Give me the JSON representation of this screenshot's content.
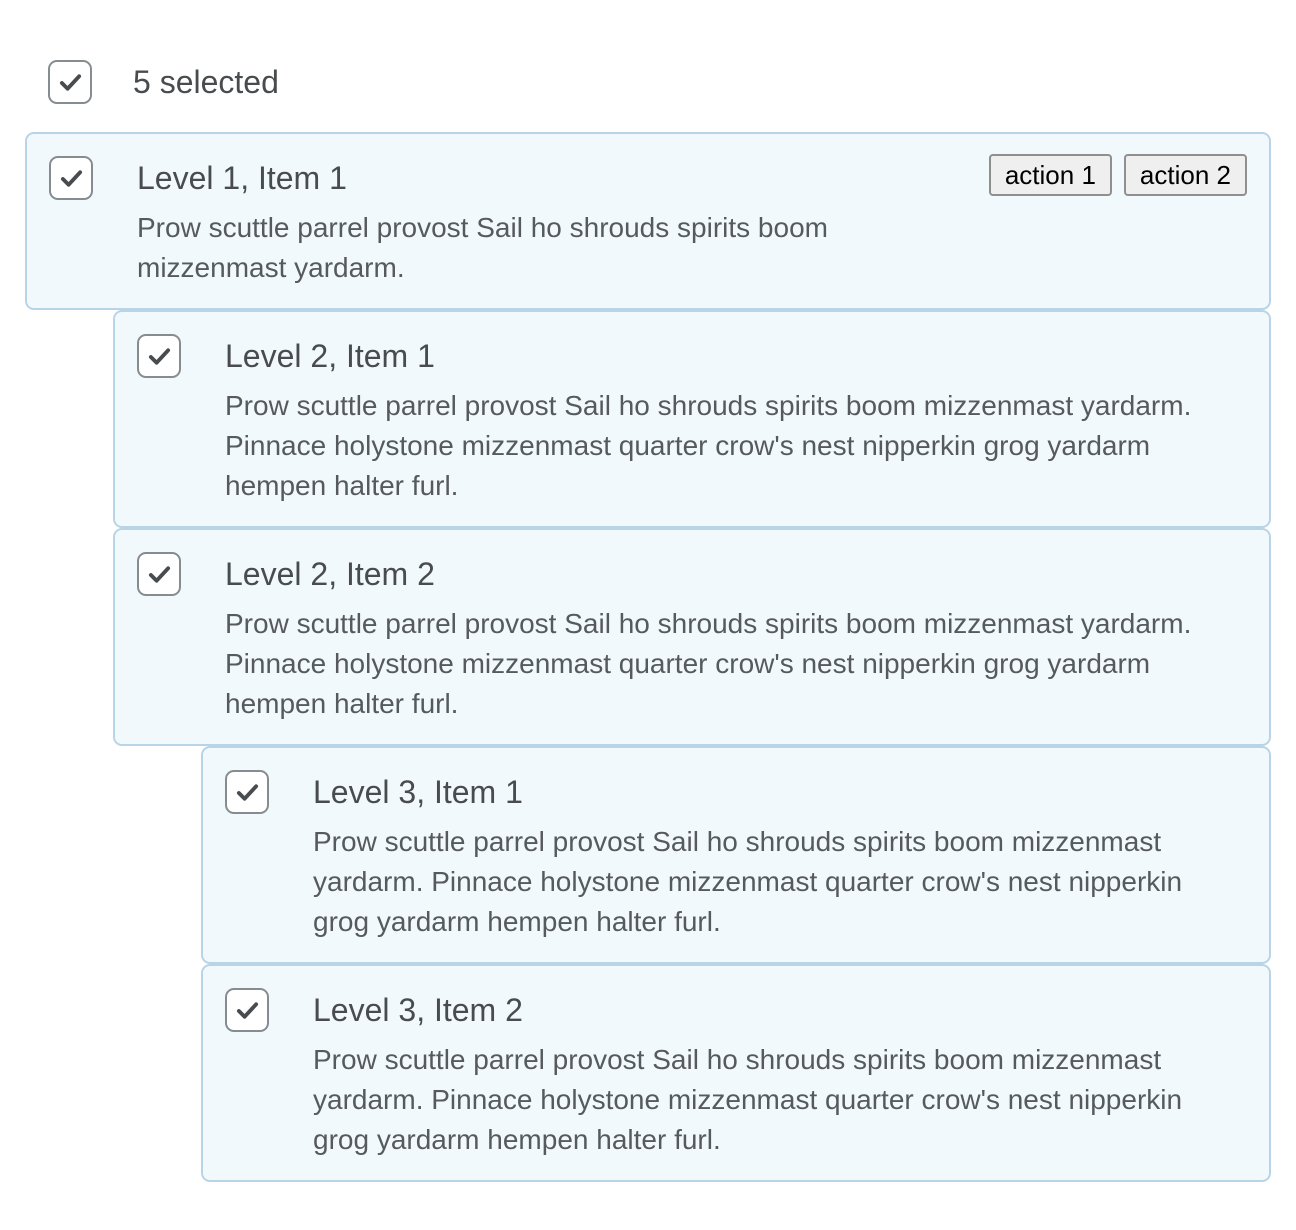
{
  "select_all": {
    "checked": true,
    "count_label": "5 selected",
    "icon": "checkmark-icon"
  },
  "colors": {
    "item_background": "#f2f9fc",
    "item_border": "#b9d4e6",
    "text": "#494c4e",
    "checkbox_border": "#868c8f"
  },
  "items": [
    {
      "level": 1,
      "checked": true,
      "title": "Level 1, Item 1",
      "description": "Prow scuttle parrel provost Sail ho shrouds spirits boom mizzenmast yardarm.",
      "actions": [
        "action 1",
        "action 2"
      ]
    },
    {
      "level": 2,
      "checked": true,
      "title": "Level 2, Item 1",
      "description": "Prow scuttle parrel provost Sail ho shrouds spirits boom mizzenmast yardarm. Pinnace holystone mizzenmast quarter crow's nest nipperkin grog yardarm hempen halter furl."
    },
    {
      "level": 2,
      "checked": true,
      "title": "Level 2, Item 2",
      "description": "Prow scuttle parrel provost Sail ho shrouds spirits boom mizzenmast yardarm. Pinnace holystone mizzenmast quarter crow's nest nipperkin grog yardarm hempen halter furl."
    },
    {
      "level": 3,
      "checked": true,
      "title": "Level 3, Item 1",
      "description": "Prow scuttle parrel provost Sail ho shrouds spirits boom mizzenmast yardarm. Pinnace holystone mizzenmast quarter crow's nest nipperkin grog yardarm hempen halter furl."
    },
    {
      "level": 3,
      "checked": true,
      "title": "Level 3, Item 2",
      "description": "Prow scuttle parrel provost Sail ho shrouds spirits boom mizzenmast yardarm. Pinnace holystone mizzenmast quarter crow's nest nipperkin grog yardarm hempen halter furl."
    }
  ]
}
